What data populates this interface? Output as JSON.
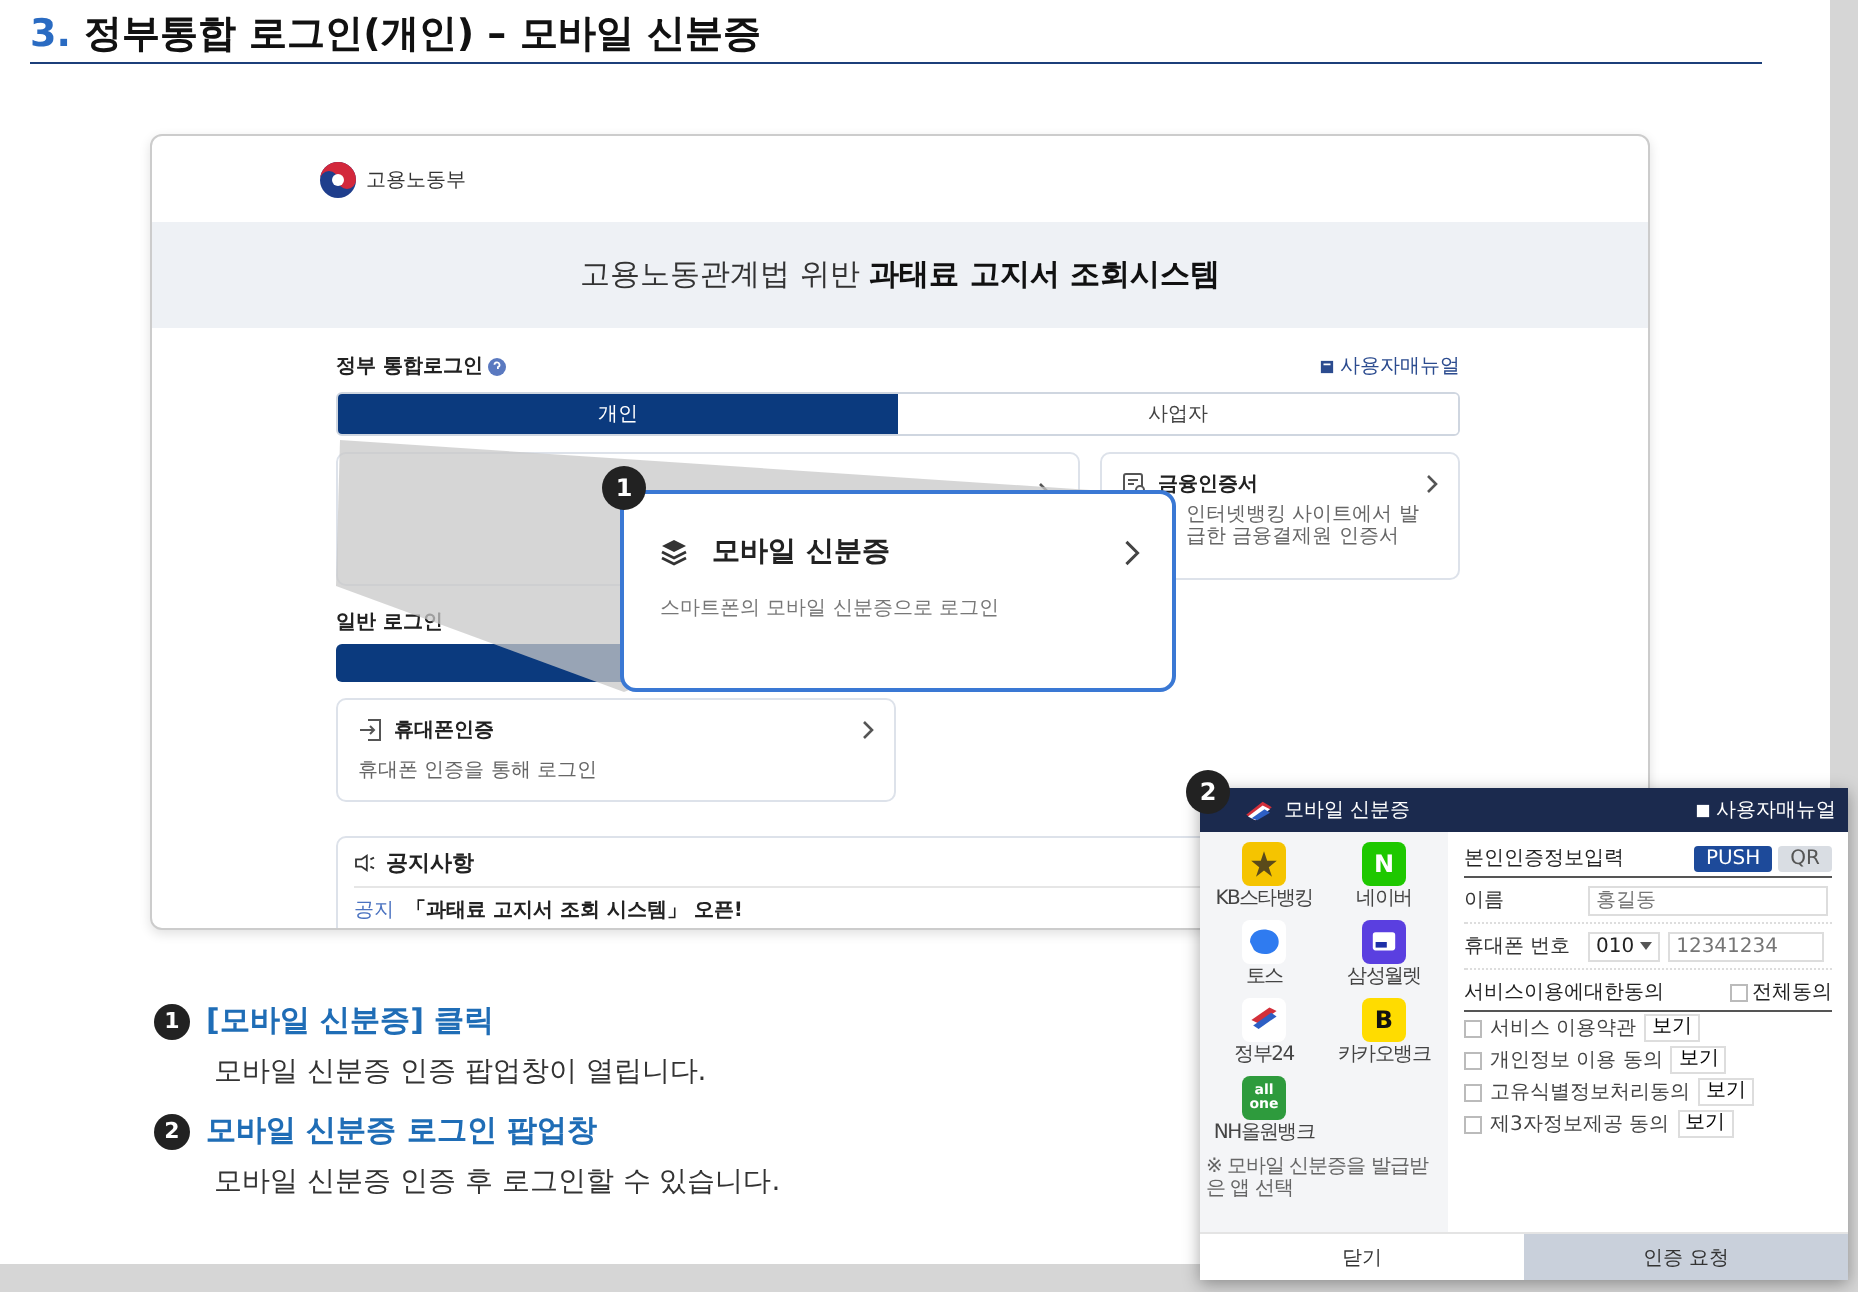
{
  "doc_title": {
    "number": "3.",
    "text": "정부통합 로그인(개인) – 모바일 신분증"
  },
  "site": {
    "ministry": "고용노동부",
    "banner_regular": "고용노동관계법 위반",
    "banner_bold": "과태료 고지서 조회시스템",
    "login_heading": "정부 통합로그인",
    "manual_link": "사용자매뉴얼",
    "tabs": [
      {
        "label": "개인",
        "selected": true
      },
      {
        "label": "사업자",
        "selected": false
      }
    ],
    "methods": [
      {
        "kind": "covered"
      },
      {
        "kind": "card",
        "title": "금융인증서",
        "description": "인터넷뱅킹 사이트에서 발급한 금융결제원 인증서"
      }
    ],
    "general_heading": "일반 로그인",
    "general_methods": [
      {
        "title": "휴대폰인증",
        "description": "휴대폰 인증을 통해 로그인"
      }
    ],
    "notice": {
      "heading": "공지사항",
      "items": [
        {
          "tag": "공지",
          "text": "「과태료 고지서 조회 시스템」 오픈!"
        }
      ]
    }
  },
  "callout": {
    "badge": "1",
    "title": "모바일 신분증",
    "description": "스마트폰의 모바일 신분증으로 로그인"
  },
  "popup": {
    "badge": "2",
    "title": "모바일 신분증",
    "manual_link": "사용자매뉴얼",
    "apps": [
      {
        "kind": "kb",
        "label": "KB스타뱅킹"
      },
      {
        "kind": "naver",
        "label": "네이버"
      },
      {
        "kind": "toss",
        "label": "토스"
      },
      {
        "kind": "wallet",
        "label": "삼성월렛"
      },
      {
        "kind": "gov",
        "label": "정부24"
      },
      {
        "kind": "kakaobank",
        "label": "카카오뱅크"
      },
      {
        "kind": "allone",
        "label": "NH올원뱅크"
      }
    ],
    "app_icon_texts": [
      {
        "kind": "naver",
        "text": "N"
      },
      {
        "kind": "kakaobank",
        "text": "B"
      },
      {
        "kind": "allone",
        "text": "all one"
      }
    ],
    "app_note": "※ 모바일 신분증을 발급받은 앱 선택",
    "form_heading": "본인인증정보입력",
    "modes": [
      {
        "label": "PUSH",
        "selected": true
      },
      {
        "label": "QR",
        "selected": false
      }
    ],
    "fields": [
      {
        "kind": "text",
        "label": "이름",
        "placeholder": "홍길동"
      },
      {
        "kind": "phone",
        "label": "휴대폰 번호",
        "carrier": "010",
        "placeholder": "12341234"
      }
    ],
    "consent_heading": "서비스이용에대한동의",
    "all_label": "전체동의",
    "all_checked": false,
    "consents": [
      {
        "label": "서비스 이용약관",
        "view": "보기",
        "checked": false
      },
      {
        "label": "개인정보 이용 동의",
        "view": "보기",
        "checked": false
      },
      {
        "label": "고유식별정보처리동의",
        "view": "보기",
        "checked": false
      },
      {
        "label": "제3자정보제공 동의",
        "view": "보기",
        "checked": false
      }
    ],
    "buttons": [
      {
        "kind": "secondary",
        "label": "닫기"
      },
      {
        "kind": "primary",
        "label": "인증 요청"
      }
    ]
  },
  "steps": [
    {
      "number": "1",
      "title": "[모바일 신분증] 클릭",
      "description": "모바일 신분증 인증 팝업창이 열립니다."
    },
    {
      "number": "2",
      "title": "모바일 신분증 로그인 팝업창",
      "description": "모바일 신분증 인증 후 로그인할 수 있습니다."
    }
  ]
}
